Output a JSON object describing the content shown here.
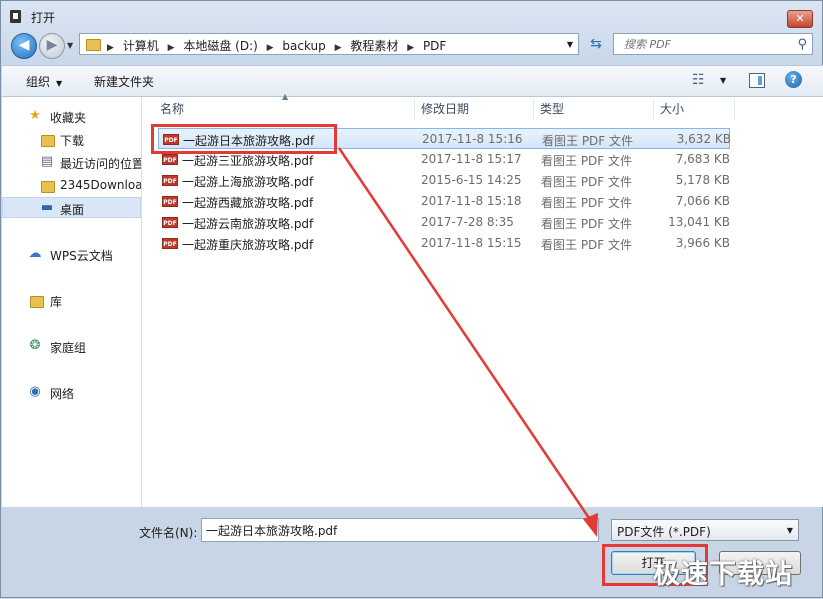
{
  "window": {
    "title": "打开",
    "close_glyph": "✕"
  },
  "nav": {
    "back_glyph": "◀",
    "forward_glyph": "▶",
    "breadcrumbs": [
      "计算机",
      "本地磁盘 (D:)",
      "backup",
      "教程素材",
      "PDF"
    ],
    "search_placeholder": "搜索 PDF"
  },
  "toolbar": {
    "organize": "组织",
    "new_folder": "新建文件夹",
    "help": "?"
  },
  "sidebar": {
    "items": [
      {
        "label": "收藏夹",
        "icon": "star-icon"
      },
      {
        "label": "下载",
        "icon": "folder-icon"
      },
      {
        "label": "最近访问的位置",
        "icon": "recent-icon"
      },
      {
        "label": "2345Downloa",
        "icon": "folder-icon"
      },
      {
        "label": "桌面",
        "icon": "desktop-icon"
      },
      {
        "label": "WPS云文档",
        "icon": "cloud-icon"
      },
      {
        "label": "库",
        "icon": "library-icon"
      },
      {
        "label": "家庭组",
        "icon": "homegroup-icon"
      },
      {
        "label": "网络",
        "icon": "network-icon"
      }
    ]
  },
  "columns": {
    "name": "名称",
    "date": "修改日期",
    "type": "类型",
    "size": "大小"
  },
  "files": [
    {
      "name": "一起游日本旅游攻略.pdf",
      "date": "2017-11-8 15:16",
      "type": "看图王 PDF 文件",
      "size": "3,632 KB"
    },
    {
      "name": "一起游三亚旅游攻略.pdf",
      "date": "2017-11-8 15:17",
      "type": "看图王 PDF 文件",
      "size": "7,683 KB"
    },
    {
      "name": "一起游上海旅游攻略.pdf",
      "date": "2015-6-15 14:25",
      "type": "看图王 PDF 文件",
      "size": "5,178 KB"
    },
    {
      "name": "一起游西藏旅游攻略.pdf",
      "date": "2017-11-8 15:18",
      "type": "看图王 PDF 文件",
      "size": "7,066 KB"
    },
    {
      "name": "一起游云南旅游攻略.pdf",
      "date": "2017-7-28 8:35",
      "type": "看图王 PDF 文件",
      "size": "13,041 KB"
    },
    {
      "name": "一起游重庆旅游攻略.pdf",
      "date": "2017-11-8 15:15",
      "type": "看图王 PDF 文件",
      "size": "3,966 KB"
    }
  ],
  "pdf_icon_text": "PDF",
  "bottom": {
    "filename_label": "文件名(N):",
    "filename_value": "一起游日本旅游攻略.pdf",
    "filter": "PDF文件 (*.PDF)",
    "open_button": "打开",
    "cancel_button": ""
  },
  "watermark": "极速下载站",
  "colors": {
    "annotation": "#e53935",
    "selection": "#d4e6fa"
  }
}
